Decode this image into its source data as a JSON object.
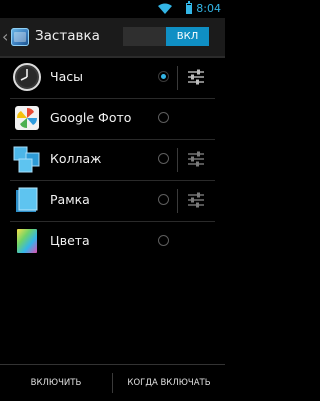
{
  "status": {
    "time": "8:04",
    "icons": [
      "wifi-icon",
      "battery-icon"
    ],
    "accent": "#33b5e5"
  },
  "actionbar": {
    "title": "Заставка",
    "toggle_label": "ВКЛ",
    "app_icon": "daydream-app-icon",
    "up_icon": "chevron-left-icon"
  },
  "items": [
    {
      "label": "Часы",
      "icon": "clock-icon",
      "selected": true,
      "has_settings": true
    },
    {
      "label": "Google Фото",
      "icon": "google-photos-icon",
      "selected": false,
      "has_settings": false
    },
    {
      "label": "Коллаж",
      "icon": "collage-icon",
      "selected": false,
      "has_settings": true
    },
    {
      "label": "Рамка",
      "icon": "frame-icon",
      "selected": false,
      "has_settings": true
    },
    {
      "label": "Цвета",
      "icon": "colors-icon",
      "selected": false,
      "has_settings": false
    }
  ],
  "bottom": {
    "start_label": "ВКЛЮЧИТЬ",
    "when_label": "КОГДА ВКЛЮЧАТЬ"
  }
}
